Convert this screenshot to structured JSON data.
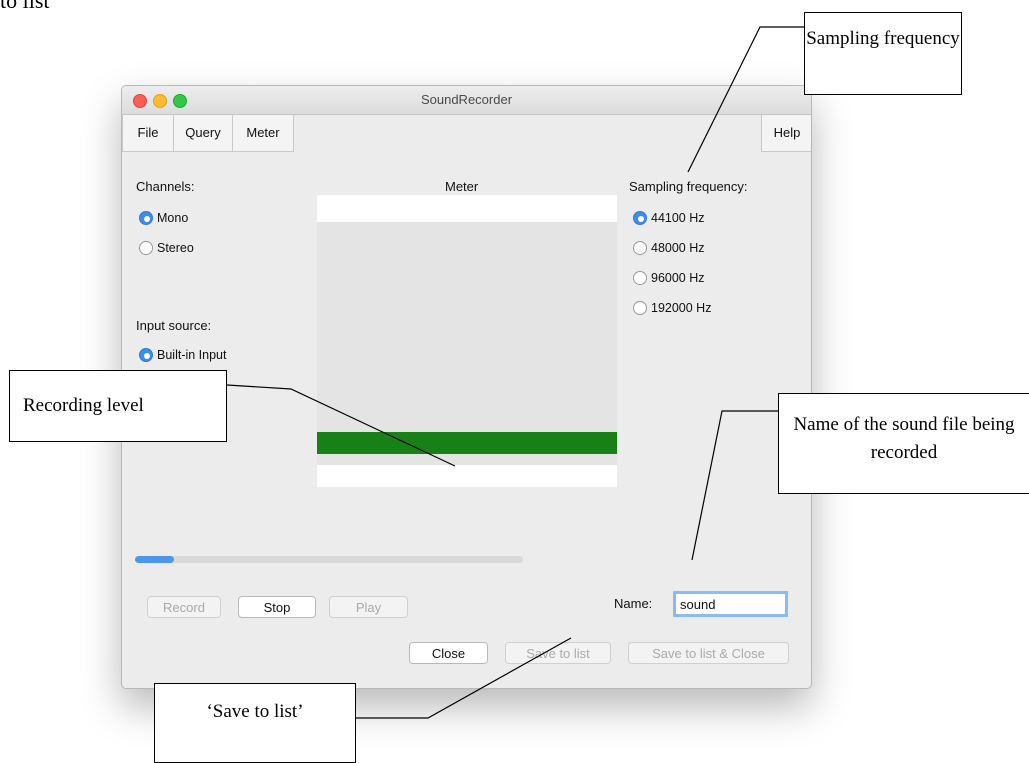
{
  "doc_fragment": "to list",
  "window": {
    "title": "SoundRecorder",
    "menu": [
      "File",
      "Query",
      "Meter",
      "Help"
    ],
    "channels": {
      "label": "Channels:",
      "options": [
        "Mono",
        "Stereo"
      ],
      "selected": "Mono"
    },
    "input_source": {
      "label": "Input source:",
      "options": [
        "Built-in Input"
      ],
      "selected": "Built-in Input"
    },
    "meter": {
      "label": "Meter",
      "level_fraction": 0.08
    },
    "sampling": {
      "label": "Sampling frequency:",
      "options": [
        "44100 Hz",
        "48000 Hz",
        "96000 Hz",
        "192000 Hz"
      ],
      "selected": "44100 Hz"
    },
    "progress_fraction": 0.1,
    "buttons": {
      "record": "Record",
      "stop": "Stop",
      "play": "Play",
      "close": "Close",
      "save_to_list": "Save to list",
      "save_to_list_close": "Save to list & Close"
    },
    "name": {
      "label": "Name:",
      "value": "sound"
    }
  },
  "callouts": {
    "sampling_frequency": "Sampling frequency",
    "recording_level": "Recording level",
    "name_of_sound_file": "Name of the sound file being recorded",
    "save_to_list": "‘Save to list’"
  },
  "colors": {
    "accent": "#3d8cf0",
    "level_bar": "#178117",
    "close_light": "#fc5f57",
    "minimize_light": "#fdbc2f",
    "maximize_light": "#33c748"
  }
}
